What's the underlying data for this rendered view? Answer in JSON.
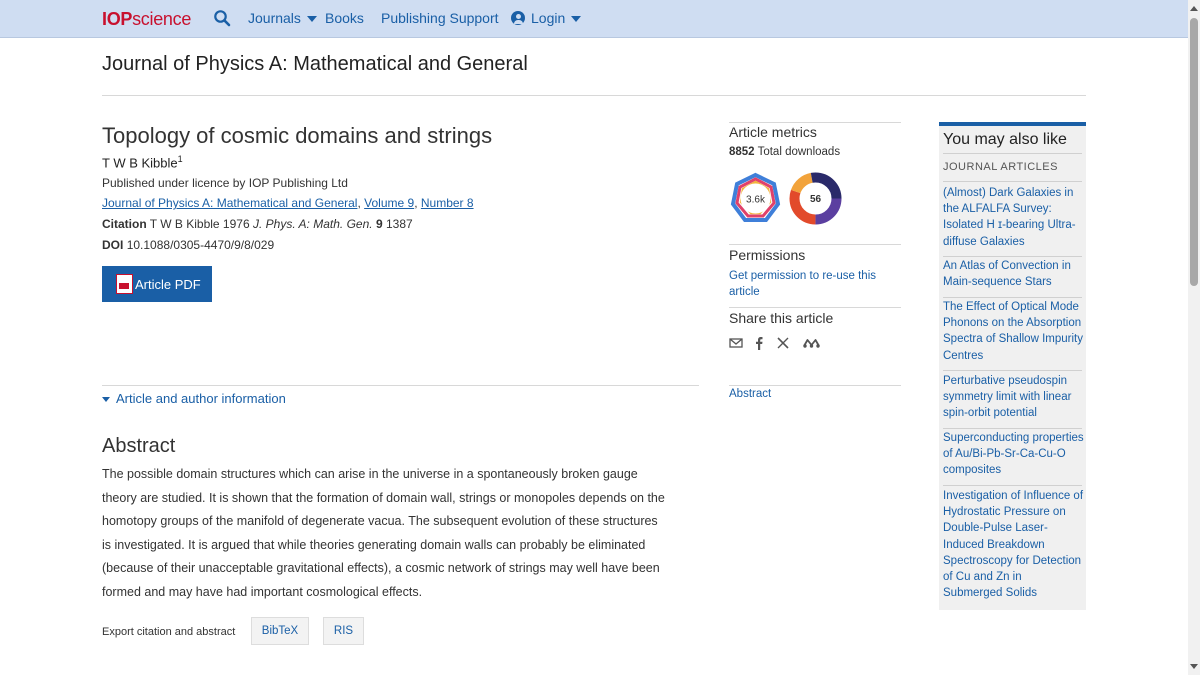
{
  "nav": {
    "logo_brand": "IOP",
    "logo_name": "science",
    "items": [
      {
        "label": "Journals"
      },
      {
        "label": "Books"
      },
      {
        "label": "Publishing Support"
      },
      {
        "label": "Login"
      }
    ]
  },
  "journal": {
    "title": "Journal of Physics A: Mathematical and General"
  },
  "article": {
    "title": "Topology of cosmic domains and strings",
    "author": "T W B Kibble",
    "author_sup": "1",
    "licence": "Published under licence by IOP Publishing Ltd",
    "journal_link": "Journal of Physics A: Mathematical and General",
    "volume_link": "Volume 9",
    "number_link": "Number 8",
    "citation_label": "Citation",
    "citation_authors": "T W B Kibble 1976",
    "citation_journal": "J. Phys. A: Math. Gen.",
    "citation_volume": "9",
    "citation_page": "1387",
    "doi_label": "DOI",
    "doi": "10.1088/0305-4470/9/8/029",
    "pdf_label": "Article PDF",
    "author_info_label": "Article and author information",
    "abstract_heading": "Abstract",
    "abstract_lines": [
      "The possible domain structures which can arise in the universe in a spontaneously broken gauge",
      "theory are studied. It is shown that the formation of domain wall, strings or monopoles depends on the",
      "homotopy groups of the manifold of degenerate vacua. The subsequent evolution of these structures",
      "is investigated. It is argued that while theories generating domain walls can probably be eliminated",
      "(because of their unacceptable gravitational effects), a cosmic network of strings may well have been",
      "formed and may have had important cosmological effects."
    ],
    "export_label": "Export citation and abstract",
    "bibtex_label": "BibTeX",
    "ris_label": "RIS"
  },
  "metrics": {
    "heading": "Article metrics",
    "downloads_count": "8852",
    "downloads_label": "Total downloads",
    "dimensions_value": "3.6k",
    "altmetric_value": "56",
    "permissions_heading": "Permissions",
    "permissions_link": "Get permission to re-use this article",
    "share_heading": "Share this article",
    "abstract_link": "Abstract"
  },
  "sidebar": {
    "title": "You may also like",
    "subtitle": "JOURNAL ARTICLES",
    "items": [
      "(Almost) Dark Galaxies in the ALFALFA Survey: Isolated H ɪ-bearing Ultra-diffuse Galaxies",
      "An Atlas of Convection in Main-sequence Stars",
      "The Effect of Optical Mode Phonons on the Absorption Spectra of Shallow Impurity Centres",
      "Perturbative pseudospin symmetry limit with linear spin-orbit potential",
      "Superconducting properties of Au/Bi-Pb-Sr-Ca-Cu-O composites",
      "Investigation of Influence of Hydrostatic Pressure on Double-Pulse Laser-Induced Breakdown Spectroscopy for Detection of Cu and Zn in Submerged Solids"
    ]
  }
}
